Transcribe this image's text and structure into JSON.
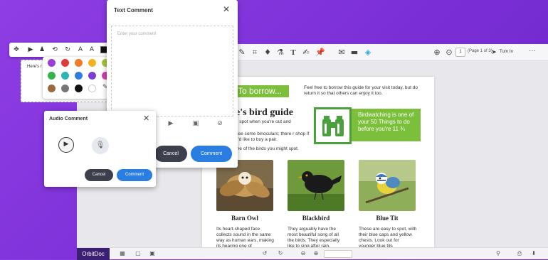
{
  "topbar": {
    "page_input": "1",
    "page_of": "(Page 1 of 3)",
    "turn_in": "Turn In",
    "more": "···"
  },
  "bottombar": {
    "brand": "OrbitDoc",
    "zoom_placeholder": ""
  },
  "document": {
    "borrow_heading": "To borrow...",
    "borrow_text": "Feel free to borrow this guide for your visit today, but do return it so that others can enjoy it too.",
    "guide_title": "ve's bird guide",
    "para1": "you spot when you're out and",
    "para2": "to use some binoculars; there r shop if you'd like to buy a pair.",
    "para3": "some of the birds you might spot.",
    "callout": "Birdwatching is one of your 50 Things to do before you're 11 ¾",
    "birds": [
      {
        "name": "Barn Owl",
        "desc": "Its heart-shaped face collects sound in the same way as human ears, making its hearing one of"
      },
      {
        "name": "Blackbird",
        "desc": "They arguably have the most beautiful song of all the birds. They especially like to sing after rain."
      },
      {
        "name": "Blue Tit",
        "desc": "These are easy to spot, with their blue caps and yellow chests. Look out for younger blue tits"
      }
    ]
  },
  "note": {
    "text": "Here's r"
  },
  "color_swatches": [
    "#9b3fd8",
    "#e23b3b",
    "#f07a2a",
    "#f3b21f",
    "#a7c93a",
    "#33b34a",
    "#2bb5b5",
    "#2f7fe0",
    "#7b3fd8",
    "#d13fb5",
    "#9b6a3c",
    "#777777",
    "#111111",
    "#ffffff"
  ],
  "text_comment": {
    "title": "Text Comment",
    "placeholder": "Enter your comment",
    "cancel": "Cancel",
    "comment": "Comment"
  },
  "audio_comment": {
    "title": "Audio Comment",
    "cancel": "Cancel",
    "comment": "Comment"
  }
}
